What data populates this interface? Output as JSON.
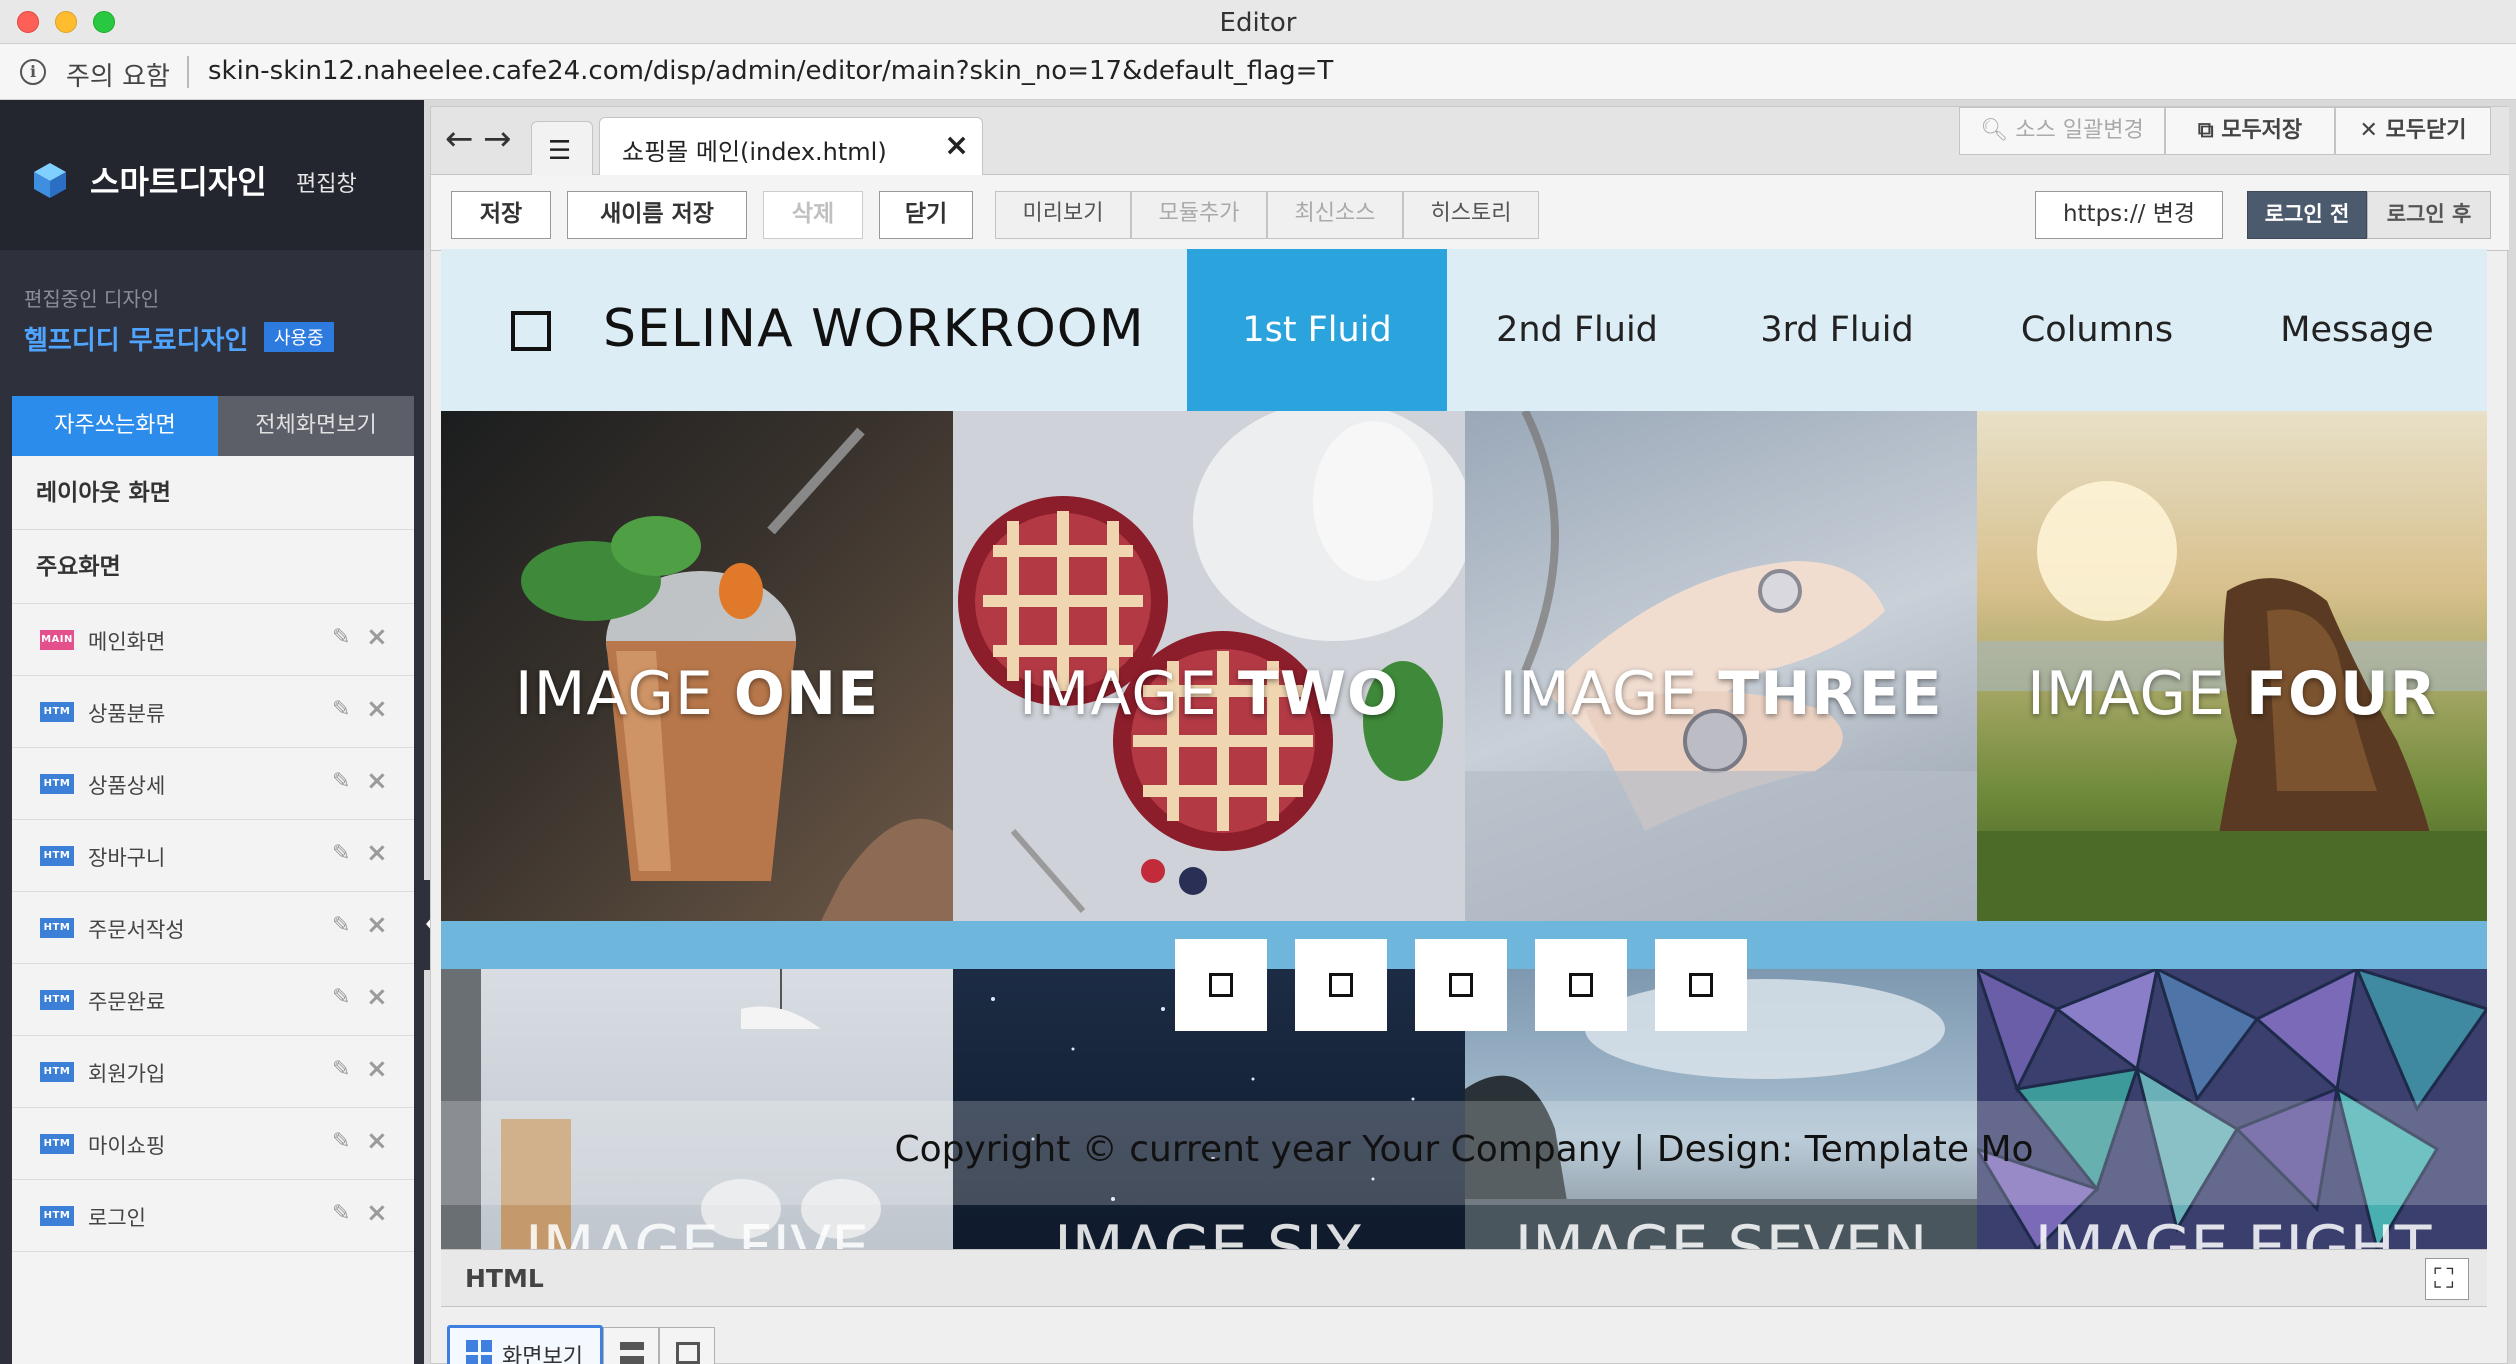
{
  "window": {
    "title": "Editor"
  },
  "urlbar": {
    "warning": "주의 요함",
    "url": "skin-skin12.naheelee.cafe24.com/disp/admin/editor/main?skin_no=17&default_flag=T"
  },
  "sidebar": {
    "brand": "스마트디자인",
    "brand_sub": "편집창",
    "editing_label": "편집중인 디자인",
    "design_name": "헬프디디 무료디자인",
    "in_use_badge": "사용중",
    "tabs": {
      "frequent": "자주쓰는화면",
      "all": "전체화면보기"
    },
    "section_layout": "레이아웃 화면",
    "section_main": "주요화면",
    "items": [
      {
        "label": "메인화면",
        "icon": "MAIN"
      },
      {
        "label": "상품분류",
        "icon": "HTM"
      },
      {
        "label": "상품상세",
        "icon": "HTM"
      },
      {
        "label": "장바구니",
        "icon": "HTM"
      },
      {
        "label": "주문서작성",
        "icon": "HTM"
      },
      {
        "label": "주문완료",
        "icon": "HTM"
      },
      {
        "label": "회원가입",
        "icon": "HTM"
      },
      {
        "label": "마이쇼핑",
        "icon": "HTM"
      },
      {
        "label": "로그인",
        "icon": "HTM"
      }
    ]
  },
  "editor": {
    "file_tab": "쇼핑몰 메인(index.html)",
    "top_buttons": {
      "source_bulk": "소스 일괄변경",
      "save_all": "모두저장",
      "close_all": "모두닫기"
    },
    "toolbar": {
      "save": "저장",
      "save_as": "새이름 저장",
      "delete": "삭제",
      "close": "닫기",
      "preview": "미리보기",
      "add_module": "모듈추가",
      "latest_source": "최신소스",
      "history": "히스토리",
      "https": "https:// 변경",
      "before_login": "로그인 전",
      "after_login": "로그인 후"
    },
    "html_label": "HTML",
    "view_screen": "화면보기"
  },
  "site": {
    "title": "SELINA WORKROOM",
    "nav": [
      "1st Fluid",
      "2nd Fluid",
      "3rd Fluid",
      "Columns",
      "Message"
    ],
    "tiles": [
      {
        "light": "IMAGE ",
        "strong": "ONE"
      },
      {
        "light": "IMAGE ",
        "strong": "TWO"
      },
      {
        "light": "IMAGE ",
        "strong": "THREE"
      },
      {
        "light": "IMAGE ",
        "strong": "FOUR"
      }
    ],
    "row2_captions": [
      "IMAGE FIVE",
      "IMAGE SIX",
      "IMAGE SEVEN",
      "IMAGE EIGHT"
    ],
    "copyright": "Copyright © current year Your Company | Design: Template Mo"
  },
  "colors": {
    "accent": "#2ba3dc",
    "sidebar": "#2e313c",
    "tab_active": "#2c8ceb"
  }
}
